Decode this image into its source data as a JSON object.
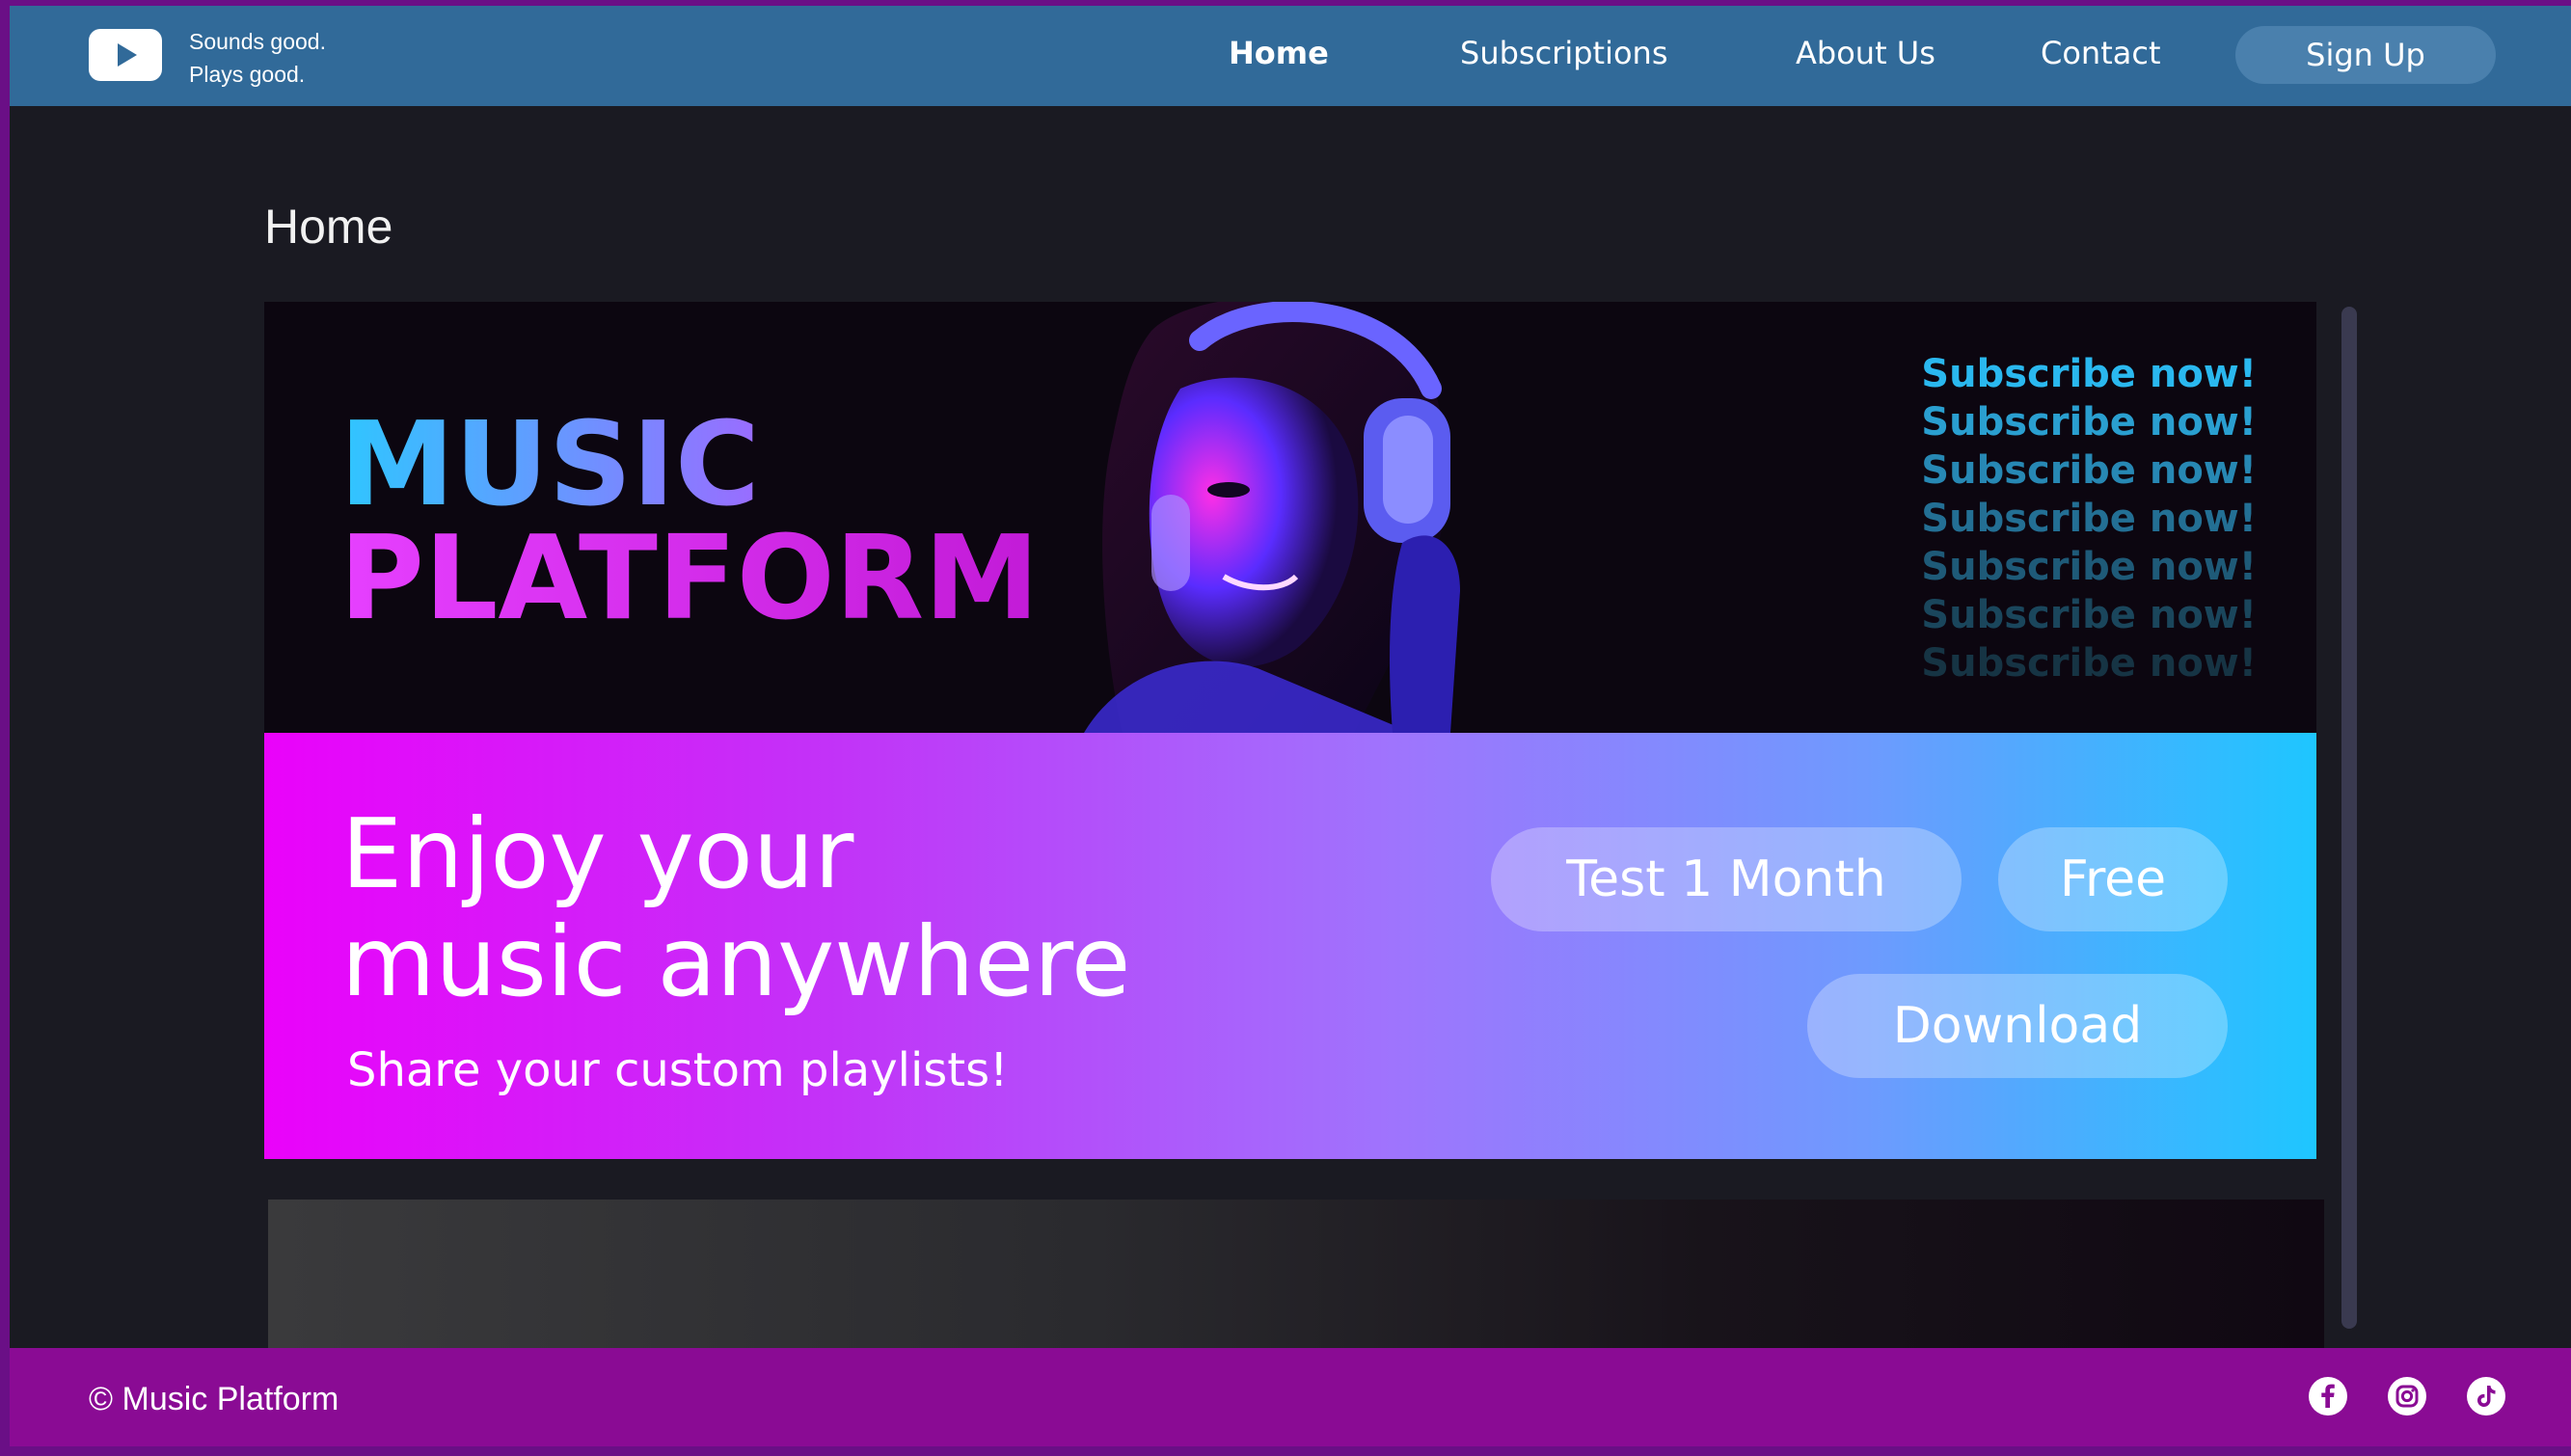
{
  "header": {
    "tagline_line1": "Sounds good.",
    "tagline_line2": "Plays good.",
    "nav": {
      "home": "Home",
      "subscriptions": "Subscriptions",
      "about": "About Us",
      "contact": "Contact"
    },
    "signup_label": "Sign Up"
  },
  "page": {
    "title": "Home"
  },
  "hero": {
    "title_line1": "MUSIC",
    "title_line2": "PLATFORM",
    "subscribe_lines": [
      "Subscribe now!",
      "Subscribe now!",
      "Subscribe now!",
      "Subscribe now!",
      "Subscribe now!",
      "Subscribe now!",
      "Subscribe now!"
    ],
    "headline_line1": "Enjoy your",
    "headline_line2": "music anywhere",
    "subtext": "Share your custom playlists!",
    "buttons": {
      "trial": "Test 1 Month",
      "free": "Free",
      "download": "Download"
    }
  },
  "footer": {
    "copyright": "© Music Platform",
    "social": [
      "facebook-icon",
      "instagram-icon",
      "tiktok-icon"
    ]
  },
  "colors": {
    "header": "#316a99",
    "footer": "#8a0b94",
    "background": "#1a1a22",
    "accent_blue": "#2fc6ff",
    "accent_magenta": "#ea02fa"
  }
}
